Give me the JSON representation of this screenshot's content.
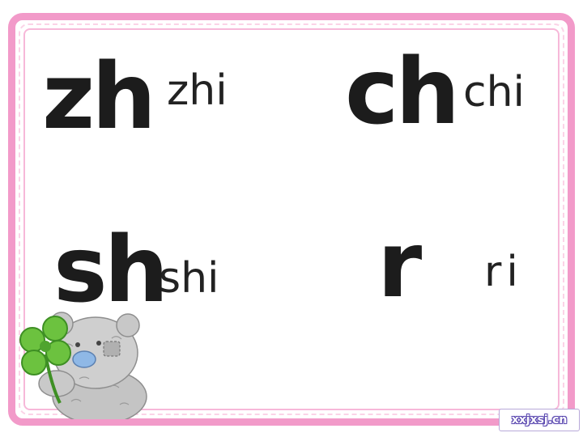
{
  "cards": {
    "zh": {
      "initial": "zh",
      "syllable": "zhi"
    },
    "ch": {
      "initial": "ch",
      "syllable": "chi"
    },
    "sh": {
      "initial": "sh",
      "syllable": "shi"
    },
    "r": {
      "initial": "r",
      "syllable": "ri"
    }
  },
  "watermark": "xxjxsj.cn",
  "colors": {
    "frame": "#f29ac9",
    "stitch": "#fbd3e7",
    "text": "#1c1c1c",
    "clover": "#5fb83a",
    "bear": "#b9b9b9"
  }
}
